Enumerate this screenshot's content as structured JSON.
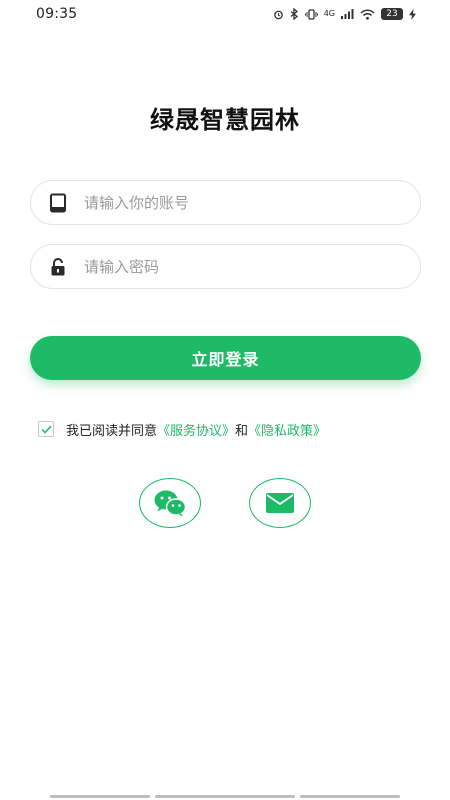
{
  "status_bar": {
    "time": "09:35",
    "network": "4G",
    "battery": "23",
    "icons": [
      "alarm-icon",
      "bluetooth-icon",
      "vibrate-icon",
      "signal-icon",
      "wifi-icon",
      "charging-icon"
    ]
  },
  "app_title": "绿晟智慧园林",
  "login_form": {
    "phone_placeholder": "请输入你的账号",
    "phone_value": "",
    "password_placeholder": "请输入密码",
    "password_value": "",
    "login_button_label": "立即登录"
  },
  "agreement": {
    "checked": true,
    "prefix": "我已阅读并同意",
    "service_link": "《服务协议》",
    "connector": "和",
    "privacy_link": "《隐私政策》"
  },
  "social_login": {
    "items": [
      "wechat-icon",
      "email-icon"
    ]
  },
  "colors": {
    "accent": "#1dba67",
    "border": "#e3e3e3",
    "placeholder": "#9a9a9a"
  }
}
